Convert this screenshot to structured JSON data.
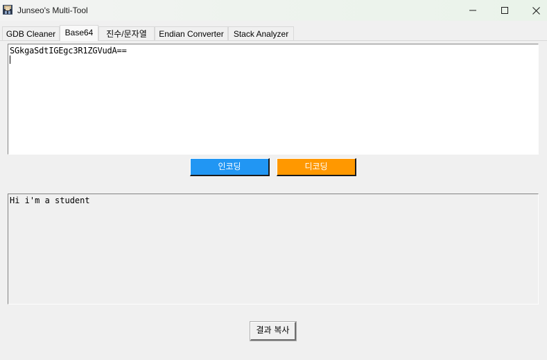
{
  "window": {
    "title": "Junseo's Multi-Tool",
    "icons": {
      "app": "app-icon",
      "minimize": "minimize-icon",
      "maximize": "maximize-icon",
      "close": "close-icon"
    }
  },
  "tabs": [
    {
      "label": "GDB Cleaner",
      "active": false
    },
    {
      "label": "Base64",
      "active": true
    },
    {
      "label": "진수/문자열",
      "active": false
    },
    {
      "label": "Endian Converter",
      "active": false
    },
    {
      "label": "Stack Analyzer",
      "active": false
    }
  ],
  "base64": {
    "input_value": "SGkgaSdtIGEgc3R1ZGVudA==",
    "encode_label": "인코딩",
    "decode_label": "디코딩",
    "output_value": "Hi i'm a student",
    "copy_label": "결과 복사"
  },
  "colors": {
    "encode_button": "#2196f3",
    "decode_button": "#ff9800",
    "window_bg": "#f0f0f0",
    "input_bg": "#ffffff"
  }
}
